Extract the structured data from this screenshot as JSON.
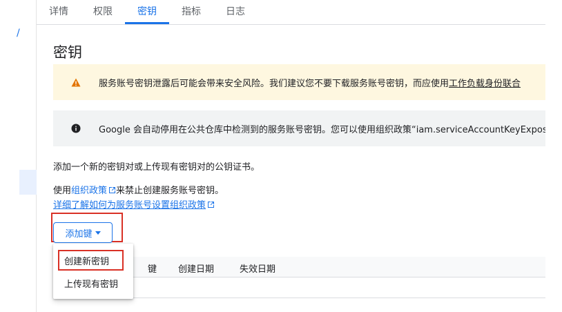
{
  "tabs": [
    {
      "label": "详情"
    },
    {
      "label": "权限"
    },
    {
      "label": "密钥"
    },
    {
      "label": "指标"
    },
    {
      "label": "日志"
    }
  ],
  "active_tab": "密钥",
  "page_title": "密钥",
  "warning_banner": {
    "text": "服务账号密钥泄露后可能会带来安全风险。我们建议您不要下载服务账号密钥，而应使用",
    "link_text": "工作负载身份联合",
    "icon": "warning-icon",
    "color": "#e37400"
  },
  "info_banner": {
    "text": "Google 会自动停用在公共仓库中检测到的服务账号密钥。您可以使用组织政策“iam.serviceAccountKeyExposureResponse”",
    "icon": "info-icon"
  },
  "description": "添加一个新的密钥对或上传现有密钥对的公钥证书。",
  "policy": {
    "prefix": "使用",
    "link": "组织政策",
    "suffix": "来禁止创建服务账号密钥。",
    "learn_more": "详细了解如何为服务账号设置组织政策"
  },
  "add_key_button": "添加键",
  "dropdown_items": [
    "创建新密钥",
    "上传现有密钥"
  ],
  "table_headers": [
    "键",
    "创建日期",
    "失效日期"
  ],
  "left_nav_glyph": "/",
  "accent_color": "#1a73e8",
  "highlight_color": "#d93025"
}
